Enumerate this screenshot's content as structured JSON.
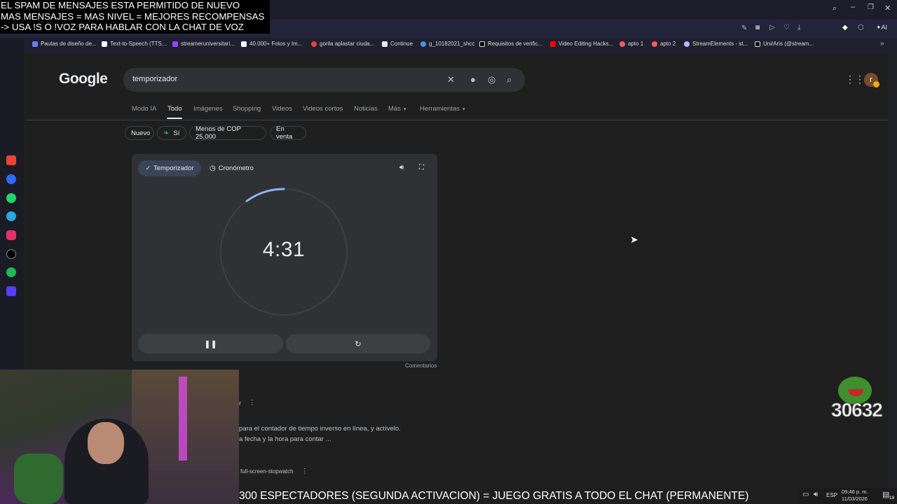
{
  "overlay": {
    "line1": "EL SPAM DE MENSAJES ESTA PERMITIDO DE NUEVO",
    "line2": "MAS MENSAJES = MAS NIVEL = MEJORES RECOMPENSAS",
    "line3": "-> USA !S O !VOZ PARA HABLAR CON LA CHAT DE VOZ"
  },
  "bookmarks": [
    "Pautas de diseño de...",
    "Text-to-Speech (TTS...",
    "streameruniversitari...",
    "40.000+ Fotos y Im...",
    "gorila aplastar ciuda...",
    "Continue",
    "g_10182021_shcc",
    "Requisitos de verific...",
    "Video Editing Hacks...",
    "apto 1",
    "apto 2",
    "StreamElements - st...",
    "Uni/Aris (@stream..."
  ],
  "google": {
    "logo": "Google",
    "query": "temporizador",
    "tabs": [
      "Modo IA",
      "Todo",
      "Imágenes",
      "Shopping",
      "Videos",
      "Videos cortos",
      "Noticias",
      "Más",
      "Herramientas"
    ],
    "chips": [
      "Nuevo",
      "Sí",
      "Menos de COP 25,000",
      "En venta"
    ],
    "avatar_letter": "r"
  },
  "timer": {
    "tab_timer": "Temporizador",
    "tab_stopwatch": "Cronómetro",
    "time": "4:31",
    "remaining_fraction": 0.9,
    "comments": "Comentarios"
  },
  "snippets": {
    "s1": "r",
    "s2": "para el contador de tiempo inverso en línea, y actívelo.",
    "s3": "a fecha y la hora para contar ...",
    "s4": "full-screen-stopwatch"
  },
  "ticker": "300 ESPECTADORES (SEGUNDA ACTIVACION) = JUEGO GRATIS A TODO EL CHAT (PERMANENTE)",
  "counter": "30632",
  "taskbar": {
    "lang": "ESP",
    "time": "09:46 p. m.",
    "date": "11/03/2026",
    "notif": "19"
  },
  "colors": {
    "page_bg": "#1f1f1f",
    "card_bg": "#303134",
    "accent": "#8ab4f8",
    "active_tab_bg": "#394457"
  }
}
